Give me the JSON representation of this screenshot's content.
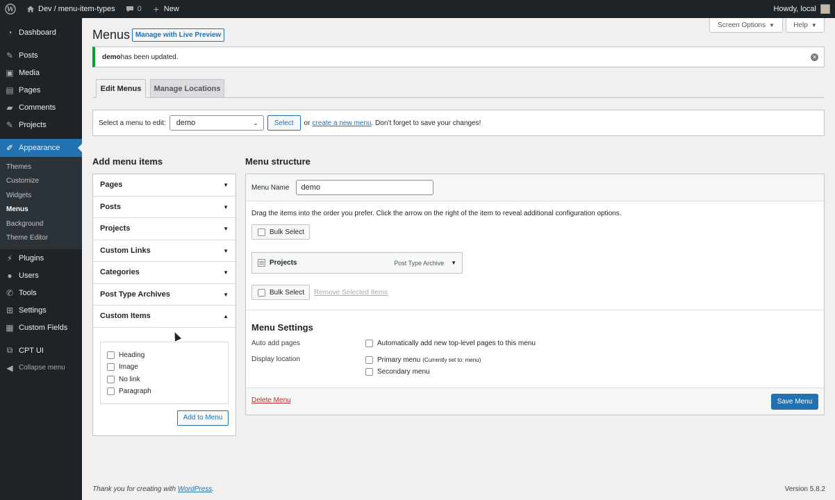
{
  "adminbar": {
    "site_name": "Dev / menu-item-types",
    "comments_count": "0",
    "new_label": "New",
    "howdy": "Howdy, local"
  },
  "sidebar": {
    "items": [
      {
        "label": "Dashboard",
        "icon": "dashboard-icon"
      },
      {
        "label": "Posts",
        "icon": "pin-icon"
      },
      {
        "label": "Media",
        "icon": "media-icon"
      },
      {
        "label": "Pages",
        "icon": "page-icon"
      },
      {
        "label": "Comments",
        "icon": "comment-icon"
      },
      {
        "label": "Projects",
        "icon": "pin-icon"
      },
      {
        "label": "Appearance",
        "icon": "brush-icon"
      },
      {
        "label": "Plugins",
        "icon": "plugin-icon"
      },
      {
        "label": "Users",
        "icon": "users-icon"
      },
      {
        "label": "Tools",
        "icon": "wrench-icon"
      },
      {
        "label": "Settings",
        "icon": "settings-icon"
      },
      {
        "label": "Custom Fields",
        "icon": "table-icon"
      },
      {
        "label": "CPT UI",
        "icon": "cptui-icon"
      },
      {
        "label": "Collapse menu",
        "icon": "collapse-icon"
      }
    ],
    "submenu": [
      "Themes",
      "Customize",
      "Widgets",
      "Menus",
      "Background",
      "Theme Editor"
    ]
  },
  "header": {
    "title": "Menus",
    "live_preview": "Manage with Live Preview",
    "screen_options": "Screen Options",
    "help": "Help"
  },
  "notice": {
    "bold": "demo",
    "text": " has been updated."
  },
  "tabs": [
    "Edit Menus",
    "Manage Locations"
  ],
  "manage": {
    "label": "Select a menu to edit:",
    "selected": "demo",
    "select_btn": "Select",
    "or": "or",
    "create_link": "create a new menu",
    "suffix": ". Don’t forget to save your changes!"
  },
  "add_items": {
    "title": "Add menu items",
    "sections": [
      "Pages",
      "Posts",
      "Projects",
      "Custom Links",
      "Categories",
      "Post Type Archives",
      "Custom Items"
    ],
    "custom_items": [
      "Heading",
      "Image",
      "No link",
      "Paragraph"
    ],
    "add_btn": "Add to Menu"
  },
  "structure": {
    "title": "Menu structure",
    "name_label": "Menu Name",
    "name_value": "demo",
    "instructions": "Drag the items into the order you prefer. Click the arrow on the right of the item to reveal additional configuration options.",
    "bulk_select": "Bulk Select",
    "item_title": "Projects",
    "item_type": "Post Type Archive",
    "remove_selected": "Remove Selected Items",
    "settings_title": "Menu Settings",
    "auto_add_label": "Auto add pages",
    "auto_add_opt": "Automatically add new top-level pages to this menu",
    "display_label": "Display location",
    "primary": "Primary menu",
    "primary_note": "(Currently set to: menu)",
    "secondary": "Secondary menu",
    "delete": "Delete Menu",
    "save": "Save Menu"
  },
  "footer": {
    "thanks": "Thank you for creating with ",
    "wp_link": "WordPress",
    "period": ".",
    "version": "Version 5.8.2"
  }
}
